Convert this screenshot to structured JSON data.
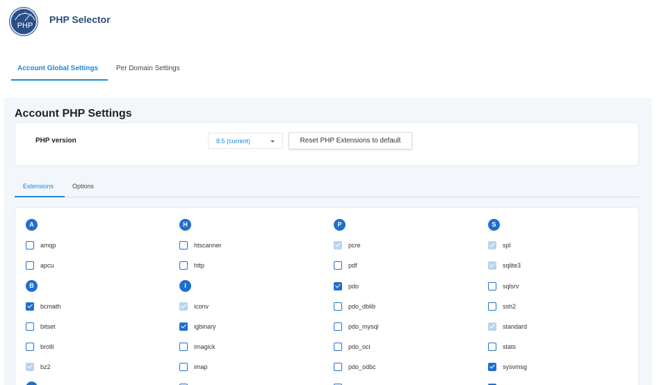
{
  "app": {
    "logo_text": "PHP",
    "title": "PHP Selector"
  },
  "top_tabs": [
    {
      "label": "Account Global Settings",
      "active": true
    },
    {
      "label": "Per Domain Settings",
      "active": false
    }
  ],
  "section": {
    "title": "Account PHP Settings",
    "version_label": "PHP version",
    "version_value": "8.5 (current)",
    "reset_button": "Reset PHP Extensions to default"
  },
  "sub_tabs": [
    {
      "label": "Extensions",
      "active": true
    },
    {
      "label": "Options",
      "active": false
    }
  ],
  "colors": {
    "accent": "#1f86d8",
    "checkbox": "#1f6fcf",
    "checkbox_disabled": "#b9d3ef",
    "title": "#2b4a7a"
  },
  "extension_columns": [
    {
      "groups": [
        {
          "letter": "A",
          "items": [
            {
              "name": "amqp",
              "state": "unchecked"
            },
            {
              "name": "apcu",
              "state": "unchecked"
            }
          ]
        },
        {
          "letter": "B",
          "items": [
            {
              "name": "bcmath",
              "state": "checked"
            },
            {
              "name": "bitset",
              "state": "unchecked"
            },
            {
              "name": "brotli",
              "state": "unchecked"
            },
            {
              "name": "bz2",
              "state": "disabled"
            }
          ]
        },
        {
          "letter": "",
          "items": []
        }
      ]
    },
    {
      "groups": [
        {
          "letter": "H",
          "items": [
            {
              "name": "htscanner",
              "state": "unchecked"
            },
            {
              "name": "http",
              "state": "unchecked"
            }
          ]
        },
        {
          "letter": "I",
          "items": [
            {
              "name": "iconv",
              "state": "disabled"
            },
            {
              "name": "igbinary",
              "state": "checked"
            },
            {
              "name": "imagick",
              "state": "unchecked"
            },
            {
              "name": "imap",
              "state": "unchecked"
            },
            {
              "name": "",
              "state": "unchecked"
            }
          ]
        }
      ]
    },
    {
      "groups": [
        {
          "letter": "P",
          "items": [
            {
              "name": "pcre",
              "state": "disabled"
            },
            {
              "name": "pdf",
              "state": "unchecked"
            },
            {
              "name": "pdo",
              "state": "checked"
            },
            {
              "name": "pdo_dblib",
              "state": "unchecked"
            },
            {
              "name": "pdo_mysql",
              "state": "unchecked"
            },
            {
              "name": "pdo_oci",
              "state": "unchecked"
            },
            {
              "name": "pdo_odbc",
              "state": "unchecked"
            },
            {
              "name": "",
              "state": "unchecked"
            }
          ]
        }
      ]
    },
    {
      "groups": [
        {
          "letter": "S",
          "items": [
            {
              "name": "spl",
              "state": "disabled"
            },
            {
              "name": "sqlite3",
              "state": "disabled"
            },
            {
              "name": "sqlsrv",
              "state": "unchecked"
            },
            {
              "name": "ssh2",
              "state": "unchecked"
            },
            {
              "name": "standard",
              "state": "disabled"
            },
            {
              "name": "stats",
              "state": "unchecked"
            },
            {
              "name": "sysvmsg",
              "state": "checked"
            },
            {
              "name": "",
              "state": "checked"
            }
          ]
        }
      ]
    }
  ]
}
